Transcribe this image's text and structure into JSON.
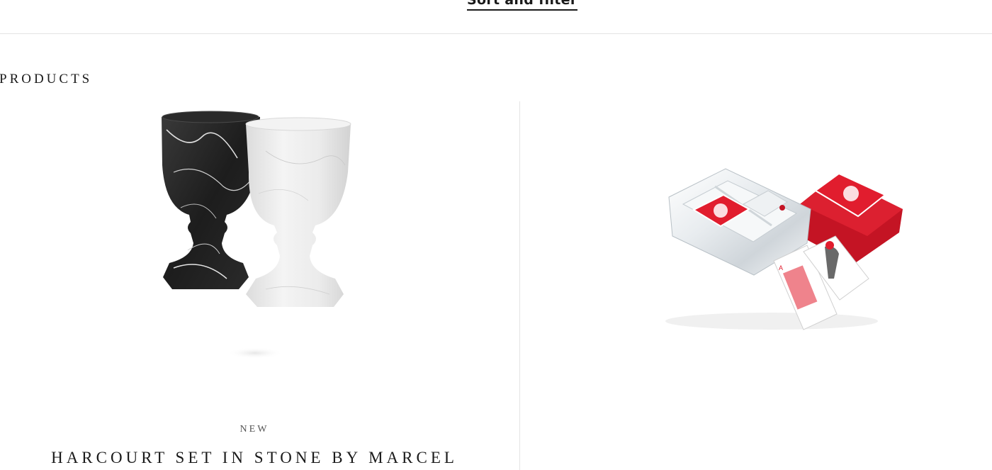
{
  "toolbar": {
    "sort_filter_label": "Sort and filter"
  },
  "section": {
    "title": "PRODUCTS"
  },
  "products": [
    {
      "tag": "NEW",
      "name": "HARCOURT SET IN STONE BY MARCEL",
      "image_icon": "marble-goblets-image"
    },
    {
      "image_icon": "crystal-card-box-image"
    }
  ],
  "colors": {
    "text": "#1a1a1a",
    "divider": "#e4e4e4",
    "accent_red": "#d7192b"
  }
}
